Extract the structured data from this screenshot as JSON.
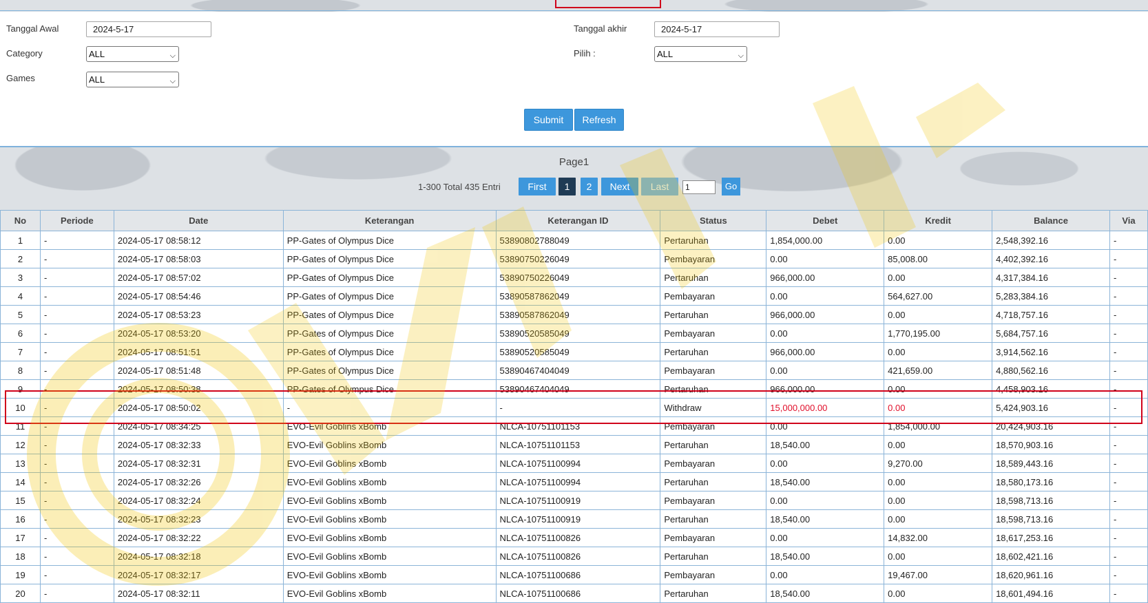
{
  "filters": {
    "tanggal_awal": {
      "label": "Tanggal Awal",
      "value": "2024-5-17"
    },
    "tanggal_akhir": {
      "label": "Tanggal akhir",
      "value": "2024-5-17"
    },
    "category": {
      "label": "Category",
      "value": "ALL"
    },
    "pilih": {
      "label": "Pilih :",
      "value": "ALL"
    },
    "games": {
      "label": "Games",
      "value": "ALL"
    },
    "submit_label": "Submit",
    "refresh_label": "Refresh"
  },
  "pagination": {
    "page_title": "Page1",
    "entries_text": "1-300 Total 435 Entri",
    "first": "First",
    "page1": "1",
    "page2": "2",
    "next": "Next",
    "last": "Last",
    "page_input": "1",
    "go": "Go"
  },
  "table": {
    "headers": [
      "No",
      "Periode",
      "Date",
      "Keterangan",
      "Keterangan ID",
      "Status",
      "Debet",
      "Kredit",
      "Balance",
      "Via"
    ],
    "rows": [
      [
        "1",
        "-",
        "2024-05-17 08:58:12",
        "PP-Gates of Olympus Dice",
        "53890802788049",
        "Pertaruhan",
        "1,854,000.00",
        "0.00",
        "2,548,392.16",
        "-"
      ],
      [
        "2",
        "-",
        "2024-05-17 08:58:03",
        "PP-Gates of Olympus Dice",
        "53890750226049",
        "Pembayaran",
        "0.00",
        "85,008.00",
        "4,402,392.16",
        "-"
      ],
      [
        "3",
        "-",
        "2024-05-17 08:57:02",
        "PP-Gates of Olympus Dice",
        "53890750226049",
        "Pertaruhan",
        "966,000.00",
        "0.00",
        "4,317,384.16",
        "-"
      ],
      [
        "4",
        "-",
        "2024-05-17 08:54:46",
        "PP-Gates of Olympus Dice",
        "53890587862049",
        "Pembayaran",
        "0.00",
        "564,627.00",
        "5,283,384.16",
        "-"
      ],
      [
        "5",
        "-",
        "2024-05-17 08:53:23",
        "PP-Gates of Olympus Dice",
        "53890587862049",
        "Pertaruhan",
        "966,000.00",
        "0.00",
        "4,718,757.16",
        "-"
      ],
      [
        "6",
        "-",
        "2024-05-17 08:53:20",
        "PP-Gates of Olympus Dice",
        "53890520585049",
        "Pembayaran",
        "0.00",
        "1,770,195.00",
        "5,684,757.16",
        "-"
      ],
      [
        "7",
        "-",
        "2024-05-17 08:51:51",
        "PP-Gates of Olympus Dice",
        "53890520585049",
        "Pertaruhan",
        "966,000.00",
        "0.00",
        "3,914,562.16",
        "-"
      ],
      [
        "8",
        "-",
        "2024-05-17 08:51:48",
        "PP-Gates of Olympus Dice",
        "53890467404049",
        "Pembayaran",
        "0.00",
        "421,659.00",
        "4,880,562.16",
        "-"
      ],
      [
        "9",
        "-",
        "2024-05-17 08:50:38",
        "PP-Gates of Olympus Dice",
        "53890467404049",
        "Pertaruhan",
        "966,000.00",
        "0.00",
        "4,458,903.16",
        "-"
      ],
      [
        "10",
        "-",
        "2024-05-17 08:50:02",
        "-",
        "-",
        "Withdraw",
        "15,000,000.00",
        "0.00",
        "5,424,903.16",
        "-"
      ],
      [
        "11",
        "-",
        "2024-05-17 08:34:25",
        "EVO-Evil Goblins xBomb",
        "NLCA-10751101153",
        "Pembayaran",
        "0.00",
        "1,854,000.00",
        "20,424,903.16",
        "-"
      ],
      [
        "12",
        "-",
        "2024-05-17 08:32:33",
        "EVO-Evil Goblins xBomb",
        "NLCA-10751101153",
        "Pertaruhan",
        "18,540.00",
        "0.00",
        "18,570,903.16",
        "-"
      ],
      [
        "13",
        "-",
        "2024-05-17 08:32:31",
        "EVO-Evil Goblins xBomb",
        "NLCA-10751100994",
        "Pembayaran",
        "0.00",
        "9,270.00",
        "18,589,443.16",
        "-"
      ],
      [
        "14",
        "-",
        "2024-05-17 08:32:26",
        "EVO-Evil Goblins xBomb",
        "NLCA-10751100994",
        "Pertaruhan",
        "18,540.00",
        "0.00",
        "18,580,173.16",
        "-"
      ],
      [
        "15",
        "-",
        "2024-05-17 08:32:24",
        "EVO-Evil Goblins xBomb",
        "NLCA-10751100919",
        "Pembayaran",
        "0.00",
        "0.00",
        "18,598,713.16",
        "-"
      ],
      [
        "16",
        "-",
        "2024-05-17 08:32:23",
        "EVO-Evil Goblins xBomb",
        "NLCA-10751100919",
        "Pertaruhan",
        "18,540.00",
        "0.00",
        "18,598,713.16",
        "-"
      ],
      [
        "17",
        "-",
        "2024-05-17 08:32:22",
        "EVO-Evil Goblins xBomb",
        "NLCA-10751100826",
        "Pembayaran",
        "0.00",
        "14,832.00",
        "18,617,253.16",
        "-"
      ],
      [
        "18",
        "-",
        "2024-05-17 08:32:18",
        "EVO-Evil Goblins xBomb",
        "NLCA-10751100826",
        "Pertaruhan",
        "18,540.00",
        "0.00",
        "18,602,421.16",
        "-"
      ],
      [
        "19",
        "-",
        "2024-05-17 08:32:17",
        "EVO-Evil Goblins xBomb",
        "NLCA-10751100686",
        "Pembayaran",
        "0.00",
        "19,467.00",
        "18,620,961.16",
        "-"
      ],
      [
        "20",
        "-",
        "2024-05-17 08:32:11",
        "EVO-Evil Goblins xBomb",
        "NLCA-10751100686",
        "Pertaruhan",
        "18,540.00",
        "0.00",
        "18,601,494.16",
        "-"
      ]
    ],
    "highlight_row": 9,
    "highlight_color": "#e0102b"
  },
  "watermark": {
    "text": "WDYWK",
    "color": "#f2c500"
  }
}
